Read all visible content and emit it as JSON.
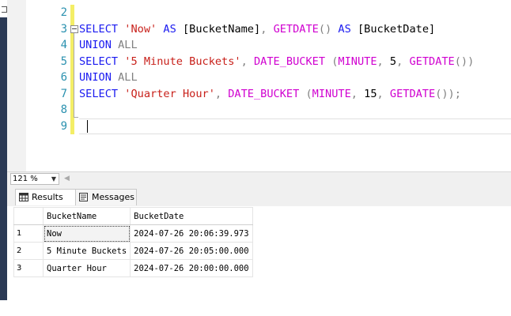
{
  "editor": {
    "line_numbers": [
      "2",
      "3",
      "4",
      "5",
      "6",
      "7",
      "8",
      "9"
    ],
    "lines": [
      [],
      [
        {
          "t": "SELECT",
          "c": "kw"
        },
        {
          "t": " ",
          "c": ""
        },
        {
          "t": "'Now'",
          "c": "str"
        },
        {
          "t": " ",
          "c": ""
        },
        {
          "t": "AS",
          "c": "kw"
        },
        {
          "t": " [BucketName]",
          "c": ""
        },
        {
          "t": ",",
          "c": "op"
        },
        {
          "t": " ",
          "c": ""
        },
        {
          "t": "GETDATE",
          "c": "fn"
        },
        {
          "t": "()",
          "c": "op"
        },
        {
          "t": " ",
          "c": ""
        },
        {
          "t": "AS",
          "c": "kw"
        },
        {
          "t": " [BucketDate]",
          "c": ""
        }
      ],
      [
        {
          "t": "UNION",
          "c": "kw"
        },
        {
          "t": " ",
          "c": ""
        },
        {
          "t": "ALL",
          "c": "kw-g"
        }
      ],
      [
        {
          "t": "SELECT",
          "c": "kw"
        },
        {
          "t": " ",
          "c": ""
        },
        {
          "t": "'5 Minute Buckets'",
          "c": "str"
        },
        {
          "t": ",",
          "c": "op"
        },
        {
          "t": " ",
          "c": ""
        },
        {
          "t": "DATE_BUCKET",
          "c": "fn"
        },
        {
          "t": " ",
          "c": ""
        },
        {
          "t": "(",
          "c": "op"
        },
        {
          "t": "MINUTE",
          "c": "fn"
        },
        {
          "t": ",",
          "c": "op"
        },
        {
          "t": " 5",
          "c": ""
        },
        {
          "t": ",",
          "c": "op"
        },
        {
          "t": " ",
          "c": ""
        },
        {
          "t": "GETDATE",
          "c": "fn"
        },
        {
          "t": "())",
          "c": "op"
        }
      ],
      [
        {
          "t": "UNION",
          "c": "kw"
        },
        {
          "t": " ",
          "c": ""
        },
        {
          "t": "ALL",
          "c": "kw-g"
        }
      ],
      [
        {
          "t": "SELECT",
          "c": "kw"
        },
        {
          "t": " ",
          "c": ""
        },
        {
          "t": "'Quarter Hour'",
          "c": "str"
        },
        {
          "t": ",",
          "c": "op"
        },
        {
          "t": " ",
          "c": ""
        },
        {
          "t": "DATE_BUCKET",
          "c": "fn"
        },
        {
          "t": " ",
          "c": ""
        },
        {
          "t": "(",
          "c": "op"
        },
        {
          "t": "MINUTE",
          "c": "fn"
        },
        {
          "t": ",",
          "c": "op"
        },
        {
          "t": " 15",
          "c": ""
        },
        {
          "t": ",",
          "c": "op"
        },
        {
          "t": " ",
          "c": ""
        },
        {
          "t": "GETDATE",
          "c": "fn"
        },
        {
          "t": "());",
          "c": "op"
        }
      ],
      [],
      []
    ]
  },
  "zoom": {
    "value": "121 %"
  },
  "tabs": {
    "results": "Results",
    "messages": "Messages"
  },
  "results": {
    "columns": [
      "BucketName",
      "BucketDate"
    ],
    "rows": [
      {
        "num": "1",
        "cells": [
          "Now",
          "2024-07-26 20:06:39.973"
        ]
      },
      {
        "num": "2",
        "cells": [
          "5 Minute Buckets",
          "2024-07-26 20:05:00.000"
        ]
      },
      {
        "num": "3",
        "cells": [
          "Quarter Hour",
          "2024-07-26 20:00:00.000"
        ]
      }
    ]
  },
  "colors": {
    "keyword": "#1a1af0",
    "string": "#c8201a",
    "function": "#d000d0",
    "line_number": "#2b91af"
  },
  "icons": {
    "results_tab": "grid-icon",
    "messages_tab": "messages-icon"
  }
}
